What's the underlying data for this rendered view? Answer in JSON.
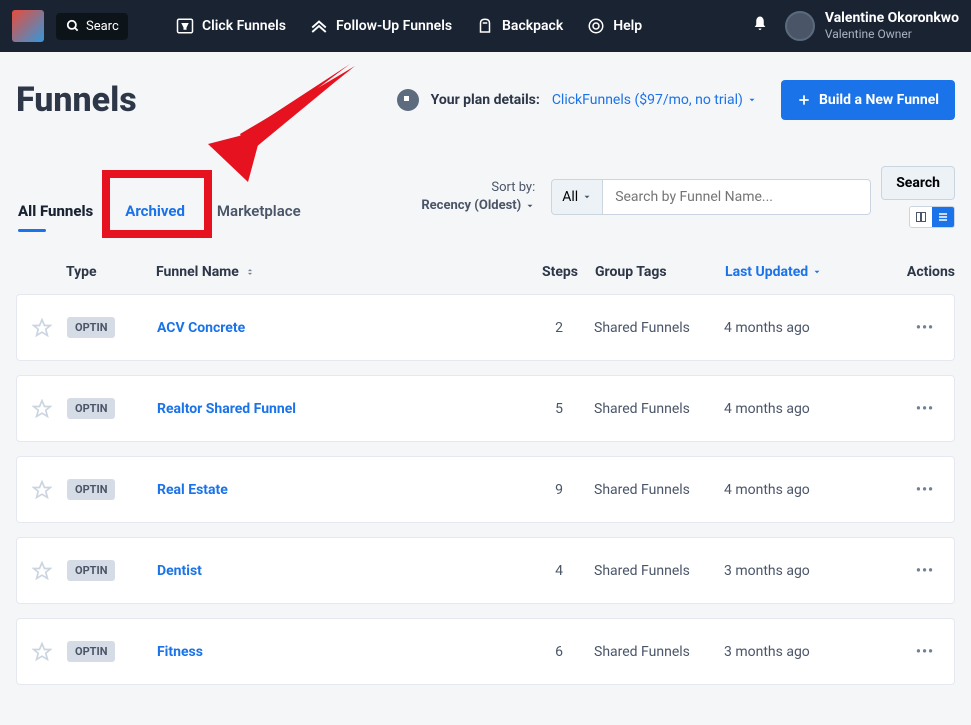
{
  "topbar": {
    "search_placeholder": "Searc",
    "nav": [
      {
        "label": "Click Funnels"
      },
      {
        "label": "Follow-Up Funnels"
      },
      {
        "label": "Backpack"
      },
      {
        "label": "Help"
      }
    ],
    "user": {
      "name": "Valentine Okoronkwo",
      "sub": "Valentine Owner"
    }
  },
  "header": {
    "title": "Funnels",
    "plan_label": "Your plan details:",
    "plan_link": "ClickFunnels ($97/mo, no trial)",
    "build_btn": "Build a New Funnel"
  },
  "tabs": {
    "all": "All Funnels",
    "archived": "Archived",
    "marketplace": "Marketplace"
  },
  "sort": {
    "label": "Sort by:",
    "value": "Recency (Oldest)"
  },
  "filter": {
    "all": "All"
  },
  "search": {
    "placeholder": "Search by Funnel Name...",
    "button": "Search"
  },
  "columns": {
    "type": "Type",
    "name": "Funnel Name",
    "steps": "Steps",
    "tags": "Group Tags",
    "updated": "Last Updated",
    "actions": "Actions"
  },
  "rows": [
    {
      "type": "OPTIN",
      "name": "ACV Concrete",
      "steps": "2",
      "tags": "Shared Funnels",
      "updated": "4 months ago"
    },
    {
      "type": "OPTIN",
      "name": "Realtor Shared Funnel",
      "steps": "5",
      "tags": "Shared Funnels",
      "updated": "4 months ago"
    },
    {
      "type": "OPTIN",
      "name": "Real Estate",
      "steps": "9",
      "tags": "Shared Funnels",
      "updated": "4 months ago"
    },
    {
      "type": "OPTIN",
      "name": "Dentist",
      "steps": "4",
      "tags": "Shared Funnels",
      "updated": "3 months ago"
    },
    {
      "type": "OPTIN",
      "name": "Fitness",
      "steps": "6",
      "tags": "Shared Funnels",
      "updated": "3 months ago"
    }
  ]
}
